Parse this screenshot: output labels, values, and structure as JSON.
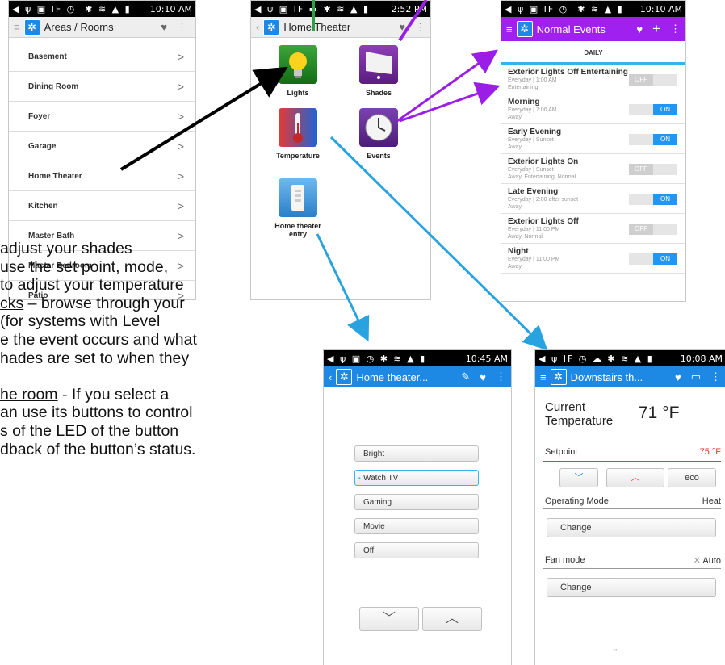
{
  "colors": {
    "blue_bar": "#1e88e5",
    "purple_bar": "#a020f0",
    "toggle_on": "#2196f3",
    "toggle_off": "#cfcfcf",
    "setpoint_red": "#e53935"
  },
  "rooms_screen": {
    "status_time": "10:10 AM",
    "status_battery": "91%",
    "title": "Areas / Rooms",
    "rooms": [
      "Basement",
      "Dining Room",
      "Foyer",
      "Garage",
      "Home Theater",
      "Kitchen",
      "Master Bath",
      "Master Bedroom",
      "Patio"
    ]
  },
  "theater_screen": {
    "status_time": "2:52 PM",
    "status_battery": "100%",
    "title": "Home Theater",
    "tiles": [
      {
        "label": "Lights",
        "icon": "lightbulb-icon"
      },
      {
        "label": "Shades",
        "icon": "shades-icon"
      },
      {
        "label": "Temperature",
        "icon": "thermometer-icon"
      },
      {
        "label": "Events",
        "icon": "clock-icon"
      },
      {
        "label": "Home theater entry",
        "icon": "keypad-icon"
      }
    ]
  },
  "events_screen": {
    "status_time": "10:10 AM",
    "status_battery": "91%",
    "title": "Normal Events",
    "section": "DAILY",
    "events": [
      {
        "name": "Exterior Lights Off Entertaining",
        "schedule": "Everyday | 1:00 AM",
        "modes": "Entertaining",
        "state": "OFF"
      },
      {
        "name": "Morning",
        "schedule": "Everyday | 7:00 AM",
        "modes": "Away",
        "state": "ON"
      },
      {
        "name": "Early Evening",
        "schedule": "Everyday | Sunset",
        "modes": "Away",
        "state": "ON"
      },
      {
        "name": "Exterior Lights On",
        "schedule": "Everyday | Sunset",
        "modes": "Away, Entertaining, Normal",
        "state": "OFF"
      },
      {
        "name": "Late Evening",
        "schedule": "Everyday | 2:00 after sunset",
        "modes": "Away",
        "state": "ON"
      },
      {
        "name": "Exterior Lights Off",
        "schedule": "Everyday | 11:00 PM",
        "modes": "Away, Normal",
        "state": "OFF"
      },
      {
        "name": "Night",
        "schedule": "Everyday | 11:00 PM",
        "modes": "Away",
        "state": "ON"
      }
    ]
  },
  "scene_screen": {
    "status_time": "10:45 AM",
    "status_battery": "93%",
    "title": "Home theater...",
    "scenes": [
      "Bright",
      "Watch TV",
      "Gaming",
      "Movie",
      "Off"
    ],
    "selected_scene": "Watch TV"
  },
  "thermostat_screen": {
    "status_time": "10:08 AM",
    "status_battery": "92%",
    "title": "Downstairs th...",
    "current_label_1": "Current",
    "current_label_2": "Temperature",
    "current_value": "71 °F",
    "setpoint_label": "Setpoint",
    "setpoint_value": "75 °F",
    "eco_label": "eco",
    "mode_label": "Operating Mode",
    "mode_value": "Heat",
    "change_label": "Change",
    "fan_label": "Fan mode",
    "fan_value": "Auto",
    "fan_change_label": "Change"
  },
  "text_lines": [
    {
      "plain": " adjust your shades"
    },
    {
      "plain": "use the set point, mode,"
    },
    {
      "plain": "to adjust your temperature"
    },
    {
      "u": "cks",
      "plain": " – browse through your"
    },
    {
      "plain": " (for systems with Level"
    },
    {
      "plain": "e the event occurs and what"
    },
    {
      "plain": "hades are set to when they"
    },
    {
      "plain": ""
    },
    {
      "u": "he room",
      "plain": " - If you select a"
    },
    {
      "plain": "an use its buttons to control"
    },
    {
      "plain": "s of the LED of the button"
    },
    {
      "plain": "dback of the button’s status."
    }
  ]
}
